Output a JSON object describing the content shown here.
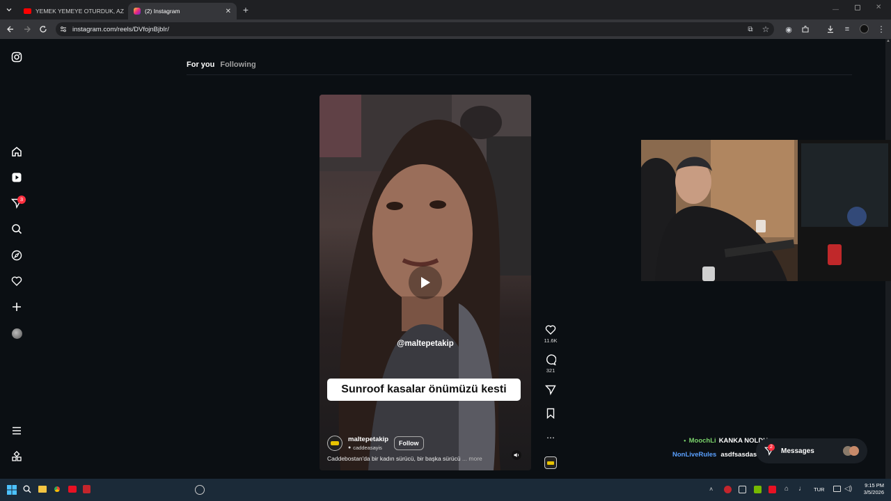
{
  "browser": {
    "tabs": [
      {
        "title": "YEMEK YEMEYE OTURDUK, AZ",
        "active": false
      },
      {
        "title": "(2) Instagram",
        "active": true
      }
    ],
    "url": "instagram.com/reels/DVfojnBjbIr/"
  },
  "sidebar": {
    "notification_count": "3"
  },
  "feed": {
    "tab_for_you": "For you",
    "tab_following": "Following"
  },
  "reel": {
    "watermark": "@maltepetakip",
    "caption_banner": "Sunroof kasalar önümüzü kesti",
    "username": "maltepetakip",
    "audio": "caddeasayis",
    "follow_label": "Follow",
    "description": "Caddebostan'da bir kadın sürücü, bir başka sürücü",
    "more_label": "... more",
    "likes": "11.6K",
    "comments": "321"
  },
  "chat": {
    "line1_user": "MoochLi",
    "line1_text": "KANKA NOLDU",
    "line2_user": "NonLiveRules",
    "line2_text": "asdfsasdasf",
    "messages_label": "Messages",
    "messages_badge": "2",
    "user_color1": "#7bd36b",
    "user_color2": "#5aa0ff"
  },
  "taskbar": {
    "language": "TUR",
    "time": "9:15 PM",
    "date": "3/5/2026"
  }
}
